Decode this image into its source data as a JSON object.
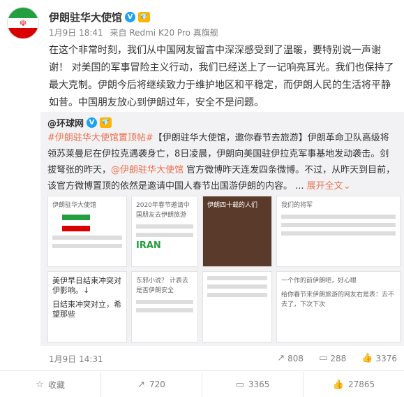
{
  "post": {
    "author": "伊朗驻华大使馆",
    "verified_mark": "V",
    "level_mark": "💎",
    "time": "1月9日 18:41",
    "source": "来自 Redmi K20 Pro 真旗舰",
    "content": "在这个非常时刻，我们从中国网友留言中深深感受到了温暖，要特别说一声谢谢！ 对美国的军事冒险主义行动，我们已经送上了一记响亮耳光。我们也保持了最大克制。伊朗今后将继续致力于维护地区和平稳定，而伊朗人民的生活将平静如昔。中国朋友放心到伊朗过年，安全不是问题。"
  },
  "repost": {
    "author": "@环球网",
    "text_link_topic": "#伊朗驻华大使馆置顶帖#",
    "text_part1": "【伊朗驻华大使馆，邀你春节去旅游】伊朗革命卫队高级将领苏莱曼尼在伊拉克遇袭身亡，8日凌晨，伊朗向美国驻伊拉克军事基地发动袭击。剑拔弩张的昨天，",
    "text_link_mention": "@伊朗驻华大使馆",
    "text_part2": " 官方微博昨天连发四条微博。不过，从昨天到目前，该官方微博置顶的依然是邀请中国人春节出国游伊朗的内容。 ...",
    "expand_label": "展开全文",
    "expand_icon": "chevron-down",
    "images": {
      "t1": "伊朗驻华大使馆",
      "t2": "2020年春节邀请中国朋友去伊朗旅游",
      "t3": "伊朗四十载的人们",
      "t4": "我们的将军",
      "t5": "美伊早日结束冲突对伊影响。↓",
      "t6": "日结束冲突对立，希望那些",
      "t7": "东邪小说？ 计表去是否伊朗安全",
      "t8": "一个作的前伊朗吧，好心眼",
      "t9": "给你春节来伊朗旅游的网友右是表：去不去了，下次下次",
      "t10": "IRAN"
    },
    "time": "1月9日 14:31",
    "repost_count": "808",
    "comment_count": "288",
    "like_count": "3376"
  },
  "actions": {
    "favorite": "收藏",
    "repost": "720",
    "comment": "3365",
    "like": "27865"
  }
}
